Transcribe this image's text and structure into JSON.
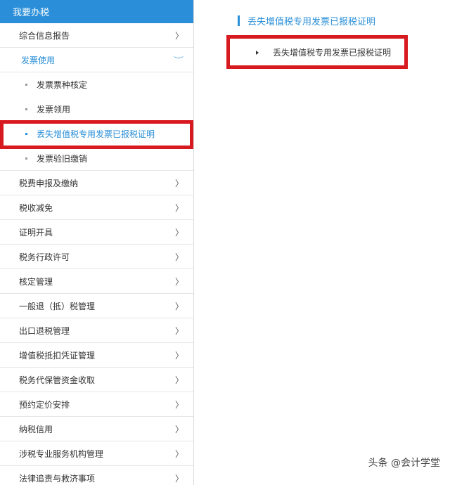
{
  "sidebar": {
    "header": "我要办税",
    "items": [
      {
        "label": "综合信息报告",
        "chevron": "〉"
      },
      {
        "label": "发票使用",
        "chevron": "︶",
        "expanded": true
      }
    ],
    "sub_items": [
      {
        "label": "发票票种核定"
      },
      {
        "label": "发票领用"
      },
      {
        "label": "丢失增值税专用发票已报税证明"
      },
      {
        "label": "发票验旧缴销"
      }
    ],
    "items_after": [
      {
        "label": "税费申报及缴纳",
        "chevron": "〉"
      },
      {
        "label": "税收减免",
        "chevron": "〉"
      },
      {
        "label": "证明开具",
        "chevron": "〉"
      },
      {
        "label": "税务行政许可",
        "chevron": "〉"
      },
      {
        "label": "核定管理",
        "chevron": "〉"
      },
      {
        "label": "一般退（抵）税管理",
        "chevron": "〉"
      },
      {
        "label": "出口退税管理",
        "chevron": "〉"
      },
      {
        "label": "增值税抵扣凭证管理",
        "chevron": "〉"
      },
      {
        "label": "税务代保管资金收取",
        "chevron": "〉"
      },
      {
        "label": "预约定价安排",
        "chevron": "〉"
      },
      {
        "label": "纳税信用",
        "chevron": "〉"
      },
      {
        "label": "涉税专业服务机构管理",
        "chevron": "〉"
      },
      {
        "label": "法律追责与救济事项",
        "chevron": "〉"
      }
    ]
  },
  "content": {
    "title": "丢失增值税专用发票已报税证明",
    "link": "丢失增值税专用发票已报税证明"
  },
  "watermark": "头条 @会计学堂",
  "colors": {
    "accent": "#2a8fd8",
    "highlight": "#d71920"
  }
}
